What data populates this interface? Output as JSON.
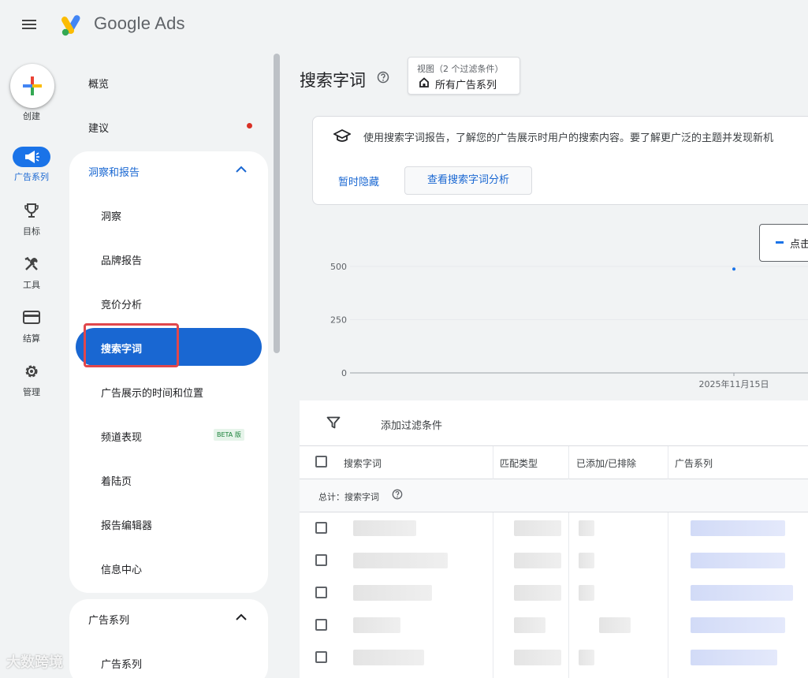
{
  "app": {
    "brand": "Google Ads"
  },
  "rail": {
    "create": "创建",
    "campaigns": "广告系列",
    "goals": "目标",
    "tools": "工具",
    "billing": "结算",
    "admin": "管理"
  },
  "nav": {
    "overview": "概览",
    "recommendations": "建议",
    "insights_section": {
      "title": "洞察和报告",
      "items": [
        "洞察",
        "品牌报告",
        "竞价分析",
        "搜索字词",
        "广告展示的时间和位置",
        "频道表现",
        "着陆页",
        "报告编辑器",
        "信息中心"
      ],
      "beta_label": "BETA 版"
    },
    "campaigns_section": {
      "title": "广告系列",
      "items": [
        "广告系列"
      ]
    }
  },
  "page": {
    "title": "搜索字词",
    "view": {
      "label": "视图（2 个过滤条件）",
      "value": "所有广告系列"
    }
  },
  "info_card": {
    "text": "使用搜索字词报告，了解您的广告展示时用户的搜索内容。要了解更广泛的主题并发现新机",
    "dismiss": "暂时隐藏",
    "action": "查看搜索字词分析"
  },
  "chart_legend": "点击",
  "chart_data": {
    "type": "line",
    "y_ticks": [
      "500",
      "250",
      "0"
    ],
    "ylim": [
      0,
      500
    ],
    "x_ticks": [
      "2025年11月15日"
    ],
    "points": [
      {
        "x": "2025年11月15日",
        "y": 488
      }
    ],
    "grid": true
  },
  "table": {
    "filter_label": "添加过滤条件",
    "columns": [
      "搜索字词",
      "匹配类型",
      "已添加/已排除",
      "广告系列"
    ],
    "total_label": "总计：搜索字词",
    "row_count": 5
  },
  "watermark": "大数跨境",
  "colors": {
    "accent": "#1967d2",
    "highlight": "#e0474c"
  }
}
